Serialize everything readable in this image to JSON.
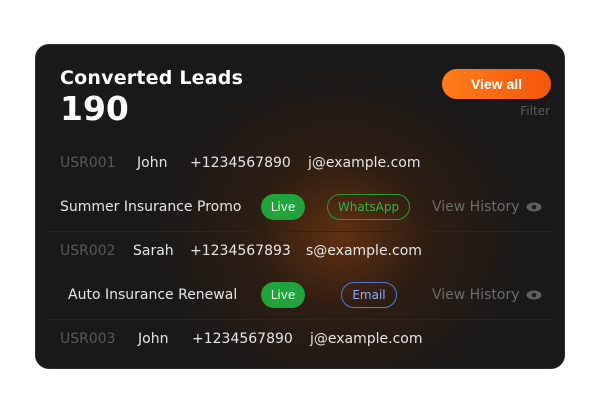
{
  "card": {
    "title": "Converted Leads",
    "count": "190",
    "view_all_label": "View all",
    "filter_label": "Filter"
  },
  "leads": [
    {
      "id": "USR001",
      "name": "John",
      "phone": "+1234567890",
      "email": "j@example.com",
      "campaign": "Summer Insurance Promo",
      "status": "Live",
      "channel": "WhatsApp",
      "history_label": "View History"
    },
    {
      "id": "USR002",
      "name": "Sarah",
      "phone": "+1234567893",
      "email": "s@example.com",
      "campaign": "Auto Insurance Renewal",
      "status": "Live",
      "channel": "Email",
      "history_label": "View History"
    },
    {
      "id": "USR003",
      "name": "John",
      "phone": "+1234567890",
      "email": "j@example.com"
    }
  ],
  "colors": {
    "accent": "#ff7d19",
    "card_bg": "#191919",
    "live_bg": "#1fa33a",
    "whatsapp": "#2fb64b",
    "email": "#8ab0ff"
  },
  "icons": {
    "history": "eye-icon"
  }
}
